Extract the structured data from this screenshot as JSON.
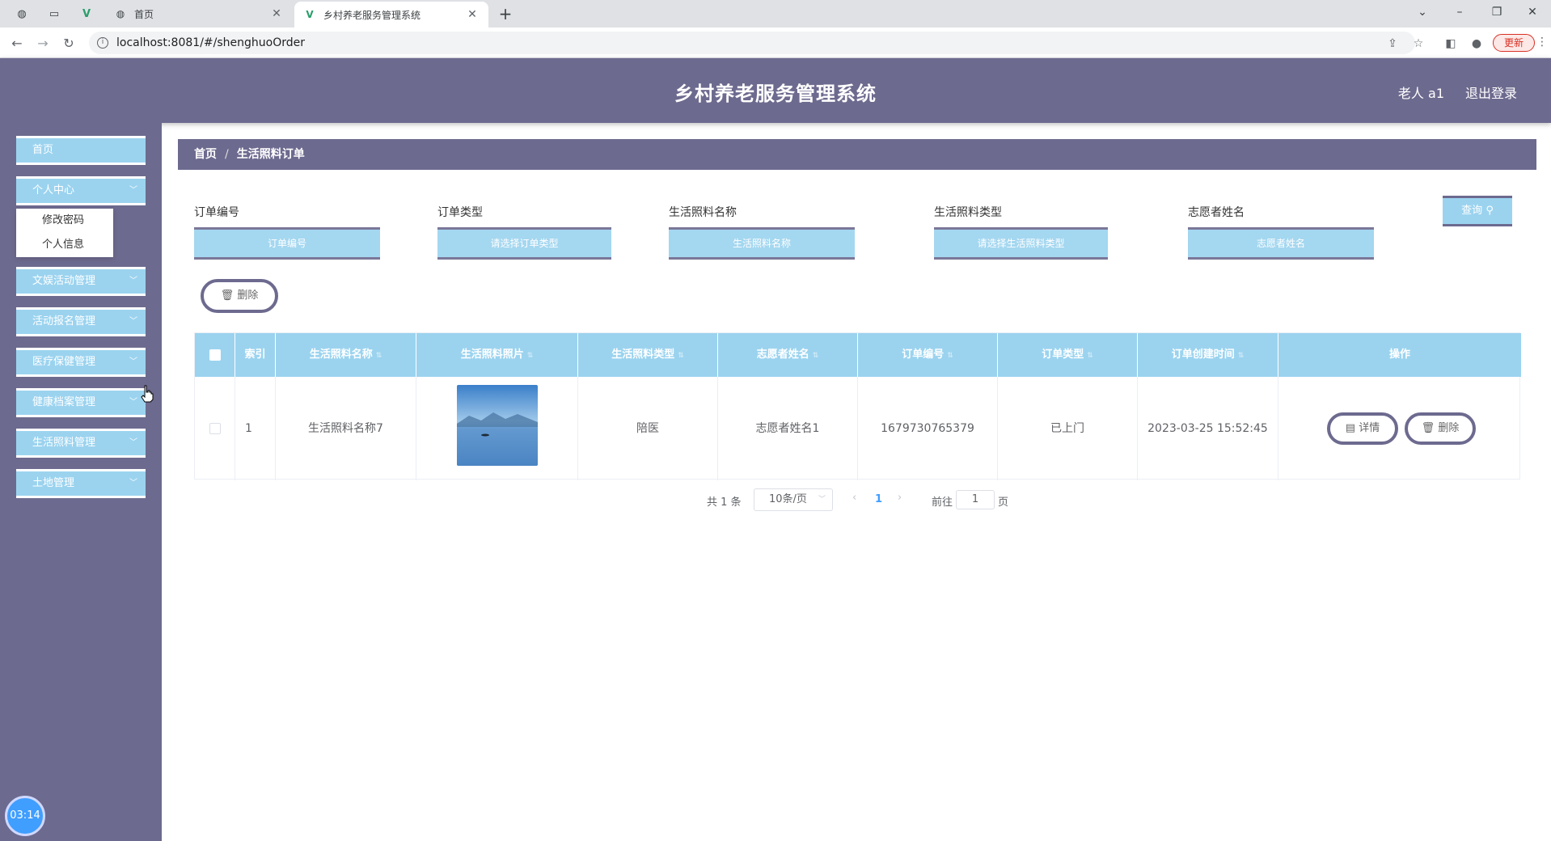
{
  "browser": {
    "tabs": [
      {
        "title": "首页",
        "active": false
      },
      {
        "title": "乡村养老服务管理系统",
        "active": true
      }
    ],
    "url": "localhost:8081/#/shenghuoOrder",
    "update_label": "更新"
  },
  "header": {
    "title": "乡村养老服务管理系统",
    "user": "老人 a1",
    "logout": "退出登录"
  },
  "sidebar": {
    "items": [
      {
        "label": "首页"
      },
      {
        "label": "个人中心"
      },
      {
        "label": "文娱活动管理"
      },
      {
        "label": "活动报名管理"
      },
      {
        "label": "医疗保健管理"
      },
      {
        "label": "健康档案管理"
      },
      {
        "label": "生活照料管理"
      },
      {
        "label": "土地管理"
      }
    ],
    "submenu": [
      "修改密码",
      "个人信息"
    ],
    "timer": "03:14"
  },
  "breadcrumb": {
    "home": "首页",
    "sep": "/",
    "current": "生活照料订单"
  },
  "filters": [
    {
      "label": "订单编号",
      "placeholder": "订单编号"
    },
    {
      "label": "订单类型",
      "placeholder": "请选择订单类型"
    },
    {
      "label": "生活照料名称",
      "placeholder": "生活照料名称"
    },
    {
      "label": "生活照料类型",
      "placeholder": "请选择生活照料类型"
    },
    {
      "label": "志愿者姓名",
      "placeholder": "志愿者姓名"
    }
  ],
  "query_label": "查询",
  "delete_label": "删除",
  "table": {
    "headers": [
      "索引",
      "生活照料名称",
      "生活照料照片",
      "生活照料类型",
      "志愿者姓名",
      "订单编号",
      "订单类型",
      "订单创建时间",
      "操作"
    ],
    "rows": [
      {
        "index": "1",
        "name": "生活照料名称7",
        "type": "陪医",
        "volunteer": "志愿者姓名1",
        "order_no": "1679730765379",
        "order_type": "已上门",
        "created": "2023-03-25 15:52:45",
        "detail_label": "详情",
        "delete_label": "删除"
      }
    ]
  },
  "pager": {
    "total": "共 1 条",
    "page_size": "10条/页",
    "current": "1",
    "goto": "前往",
    "goto_value": "1",
    "page_suffix": "页"
  }
}
